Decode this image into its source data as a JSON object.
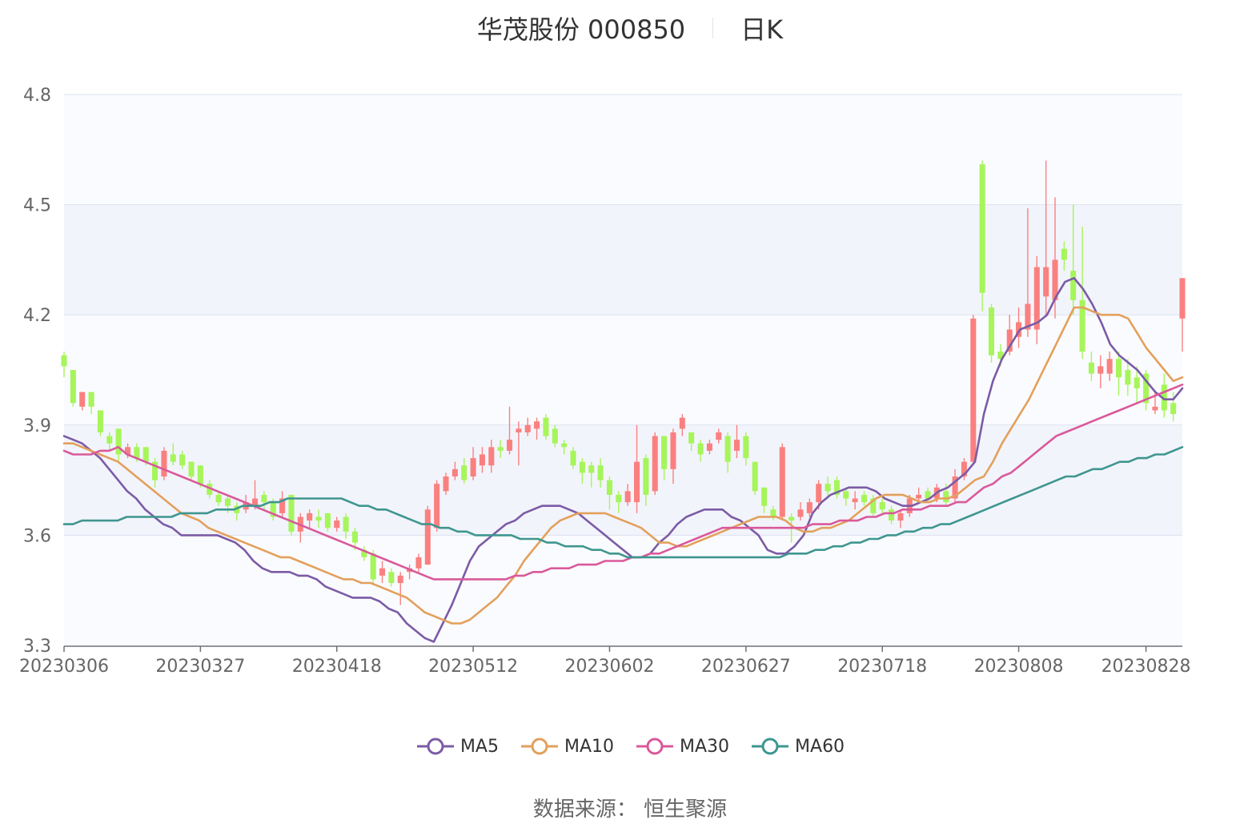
{
  "title": {
    "stock": "华茂股份 000850",
    "period": "日K"
  },
  "source": "数据来源： 恒生聚源",
  "colors": {
    "up": "#fa8080",
    "down": "#a6f55a",
    "MA5": "#7b5ba6",
    "MA10": "#e3a05c",
    "MA30": "#d9599a",
    "MA60": "#3e968f",
    "grid": "#dde1f0",
    "band": "#f2f4fb"
  },
  "chart_data": {
    "type": "candlestick",
    "ylim": [
      3.3,
      4.8
    ],
    "yticks": [
      "3.3",
      "3.6",
      "3.9",
      "4.2",
      "4.5",
      "4.8"
    ],
    "xticks": [
      {
        "i": 0,
        "label": "20230306"
      },
      {
        "i": 15,
        "label": "20230327"
      },
      {
        "i": 30,
        "label": "20230418"
      },
      {
        "i": 45,
        "label": "20230512"
      },
      {
        "i": 60,
        "label": "20230602"
      },
      {
        "i": 75,
        "label": "20230627"
      },
      {
        "i": 90,
        "label": "20230718"
      },
      {
        "i": 105,
        "label": "20230808"
      },
      {
        "i": 119,
        "label": "20230828"
      }
    ],
    "candles": [
      [
        4.09,
        4.06,
        4.1,
        4.03
      ],
      [
        4.05,
        3.96,
        4.05,
        3.95
      ],
      [
        3.95,
        3.99,
        3.99,
        3.94
      ],
      [
        3.99,
        3.95,
        3.99,
        3.93
      ],
      [
        3.94,
        3.88,
        3.94,
        3.87
      ],
      [
        3.87,
        3.85,
        3.88,
        3.83
      ],
      [
        3.89,
        3.82,
        3.89,
        3.8
      ],
      [
        3.82,
        3.84,
        3.85,
        3.81
      ],
      [
        3.84,
        3.81,
        3.85,
        3.8
      ],
      [
        3.84,
        3.8,
        3.84,
        3.79
      ],
      [
        3.8,
        3.75,
        3.81,
        3.73
      ],
      [
        3.76,
        3.83,
        3.84,
        3.75
      ],
      [
        3.82,
        3.8,
        3.85,
        3.79
      ],
      [
        3.82,
        3.79,
        3.83,
        3.78
      ],
      [
        3.8,
        3.76,
        3.8,
        3.75
      ],
      [
        3.79,
        3.74,
        3.79,
        3.73
      ],
      [
        3.74,
        3.71,
        3.75,
        3.7
      ],
      [
        3.71,
        3.69,
        3.72,
        3.68
      ],
      [
        3.7,
        3.68,
        3.71,
        3.66
      ],
      [
        3.68,
        3.66,
        3.69,
        3.64
      ],
      [
        3.67,
        3.69,
        3.71,
        3.66
      ],
      [
        3.68,
        3.7,
        3.75,
        3.67
      ],
      [
        3.71,
        3.69,
        3.72,
        3.67
      ],
      [
        3.69,
        3.65,
        3.7,
        3.64
      ],
      [
        3.66,
        3.7,
        3.72,
        3.65
      ],
      [
        3.71,
        3.61,
        3.71,
        3.6
      ],
      [
        3.61,
        3.65,
        3.66,
        3.58
      ],
      [
        3.64,
        3.66,
        3.67,
        3.62
      ],
      [
        3.65,
        3.64,
        3.67,
        3.62
      ],
      [
        3.66,
        3.62,
        3.66,
        3.61
      ],
      [
        3.62,
        3.64,
        3.65,
        3.61
      ],
      [
        3.65,
        3.61,
        3.66,
        3.59
      ],
      [
        3.61,
        3.58,
        3.62,
        3.56
      ],
      [
        3.56,
        3.54,
        3.57,
        3.53
      ],
      [
        3.55,
        3.48,
        3.56,
        3.47
      ],
      [
        3.49,
        3.51,
        3.53,
        3.47
      ],
      [
        3.5,
        3.47,
        3.51,
        3.46
      ],
      [
        3.47,
        3.49,
        3.5,
        3.41
      ],
      [
        3.5,
        3.51,
        3.52,
        3.48
      ],
      [
        3.51,
        3.54,
        3.55,
        3.5
      ],
      [
        3.52,
        3.67,
        3.68,
        3.52
      ],
      [
        3.62,
        3.74,
        3.75,
        3.61
      ],
      [
        3.72,
        3.76,
        3.77,
        3.71
      ],
      [
        3.76,
        3.78,
        3.8,
        3.75
      ],
      [
        3.79,
        3.75,
        3.81,
        3.74
      ],
      [
        3.76,
        3.81,
        3.84,
        3.75
      ],
      [
        3.79,
        3.82,
        3.84,
        3.77
      ],
      [
        3.79,
        3.84,
        3.86,
        3.77
      ],
      [
        3.84,
        3.83,
        3.86,
        3.81
      ],
      [
        3.83,
        3.86,
        3.95,
        3.82
      ],
      [
        3.88,
        3.89,
        3.91,
        3.79
      ],
      [
        3.88,
        3.9,
        3.92,
        3.87
      ],
      [
        3.89,
        3.91,
        3.92,
        3.86
      ],
      [
        3.92,
        3.87,
        3.93,
        3.86
      ],
      [
        3.89,
        3.85,
        3.9,
        3.84
      ],
      [
        3.85,
        3.84,
        3.86,
        3.82
      ],
      [
        3.83,
        3.79,
        3.84,
        3.78
      ],
      [
        3.8,
        3.77,
        3.81,
        3.74
      ],
      [
        3.79,
        3.77,
        3.8,
        3.73
      ],
      [
        3.79,
        3.75,
        3.81,
        3.73
      ],
      [
        3.75,
        3.71,
        3.76,
        3.67
      ],
      [
        3.71,
        3.69,
        3.72,
        3.66
      ],
      [
        3.69,
        3.72,
        3.74,
        3.68
      ],
      [
        3.69,
        3.8,
        3.9,
        3.66
      ],
      [
        3.81,
        3.71,
        3.82,
        3.68
      ],
      [
        3.72,
        3.87,
        3.88,
        3.71
      ],
      [
        3.87,
        3.78,
        3.87,
        3.75
      ],
      [
        3.78,
        3.88,
        3.89,
        3.74
      ],
      [
        3.89,
        3.92,
        3.93,
        3.87
      ],
      [
        3.88,
        3.85,
        3.88,
        3.83
      ],
      [
        3.85,
        3.82,
        3.86,
        3.8
      ],
      [
        3.83,
        3.85,
        3.86,
        3.82
      ],
      [
        3.86,
        3.88,
        3.89,
        3.85
      ],
      [
        3.87,
        3.8,
        3.88,
        3.77
      ],
      [
        3.83,
        3.86,
        3.9,
        3.81
      ],
      [
        3.87,
        3.81,
        3.88,
        3.79
      ],
      [
        3.8,
        3.72,
        3.8,
        3.71
      ],
      [
        3.73,
        3.68,
        3.73,
        3.66
      ],
      [
        3.67,
        3.65,
        3.68,
        3.64
      ],
      [
        3.65,
        3.84,
        3.85,
        3.64
      ],
      [
        3.65,
        3.64,
        3.66,
        3.58
      ],
      [
        3.65,
        3.67,
        3.69,
        3.64
      ],
      [
        3.66,
        3.69,
        3.7,
        3.65
      ],
      [
        3.69,
        3.74,
        3.75,
        3.67
      ],
      [
        3.74,
        3.72,
        3.76,
        3.7
      ],
      [
        3.75,
        3.71,
        3.76,
        3.7
      ],
      [
        3.72,
        3.7,
        3.73,
        3.68
      ],
      [
        3.69,
        3.7,
        3.72,
        3.67
      ],
      [
        3.71,
        3.69,
        3.72,
        3.68
      ],
      [
        3.7,
        3.66,
        3.71,
        3.65
      ],
      [
        3.69,
        3.67,
        3.7,
        3.66
      ],
      [
        3.67,
        3.64,
        3.68,
        3.63
      ],
      [
        3.64,
        3.66,
        3.67,
        3.62
      ],
      [
        3.66,
        3.7,
        3.71,
        3.65
      ],
      [
        3.7,
        3.71,
        3.73,
        3.69
      ],
      [
        3.72,
        3.7,
        3.73,
        3.69
      ],
      [
        3.7,
        3.73,
        3.74,
        3.69
      ],
      [
        3.72,
        3.69,
        3.74,
        3.68
      ],
      [
        3.7,
        3.76,
        3.78,
        3.69
      ],
      [
        3.76,
        3.8,
        3.81,
        3.75
      ],
      [
        3.8,
        4.19,
        4.2,
        3.79
      ],
      [
        4.61,
        4.26,
        4.62,
        4.21
      ],
      [
        4.22,
        4.09,
        4.23,
        4.07
      ],
      [
        4.1,
        4.08,
        4.12,
        4.06
      ],
      [
        4.1,
        4.16,
        4.2,
        4.09
      ],
      [
        4.14,
        4.18,
        4.22,
        4.11
      ],
      [
        4.16,
        4.23,
        4.49,
        4.14
      ],
      [
        4.16,
        4.33,
        4.36,
        4.12
      ],
      [
        4.25,
        4.33,
        4.62,
        4.2
      ],
      [
        4.24,
        4.35,
        4.52,
        4.19
      ],
      [
        4.38,
        4.35,
        4.4,
        4.32
      ],
      [
        4.32,
        4.24,
        4.5,
        4.2
      ],
      [
        4.24,
        4.1,
        4.44,
        4.08
      ],
      [
        4.07,
        4.04,
        4.1,
        4.02
      ],
      [
        4.04,
        4.06,
        4.09,
        4.0
      ],
      [
        4.04,
        4.08,
        4.1,
        4.02
      ],
      [
        4.08,
        4.03,
        4.1,
        3.98
      ],
      [
        4.05,
        4.01,
        4.08,
        3.98
      ],
      [
        4.03,
        4.0,
        4.06,
        3.96
      ],
      [
        4.04,
        3.96,
        4.05,
        3.94
      ],
      [
        3.94,
        3.95,
        3.99,
        3.93
      ],
      [
        4.01,
        3.94,
        4.04,
        3.92
      ],
      [
        3.96,
        3.93,
        3.99,
        3.91
      ],
      [
        4.19,
        4.3,
        4.3,
        4.1
      ]
    ],
    "ma_series": [
      {
        "name": "MA5",
        "values": [
          3.87,
          3.86,
          3.85,
          3.83,
          3.81,
          3.78,
          3.75,
          3.72,
          3.7,
          3.67,
          3.65,
          3.63,
          3.62,
          3.6,
          3.6,
          3.6,
          3.6,
          3.6,
          3.59,
          3.58,
          3.56,
          3.53,
          3.51,
          3.5,
          3.5,
          3.5,
          3.49,
          3.49,
          3.48,
          3.46,
          3.45,
          3.44,
          3.43,
          3.43,
          3.43,
          3.42,
          3.4,
          3.39,
          3.36,
          3.34,
          3.32,
          3.31,
          3.36,
          3.41,
          3.47,
          3.53,
          3.57,
          3.59,
          3.61,
          3.63,
          3.64,
          3.66,
          3.67,
          3.68,
          3.68,
          3.68,
          3.67,
          3.66,
          3.64,
          3.62,
          3.6,
          3.58,
          3.56,
          3.54,
          3.54,
          3.55,
          3.58,
          3.6,
          3.63,
          3.65,
          3.66,
          3.67,
          3.67,
          3.67,
          3.65,
          3.64,
          3.62,
          3.6,
          3.56,
          3.55,
          3.55,
          3.57,
          3.6,
          3.66,
          3.69,
          3.71,
          3.72,
          3.73,
          3.73,
          3.73,
          3.72,
          3.7,
          3.69,
          3.68,
          3.68,
          3.69,
          3.7,
          3.72,
          3.73,
          3.75,
          3.77,
          3.8,
          3.93,
          4.02,
          4.08,
          4.12,
          4.16,
          4.17,
          4.18,
          4.2,
          4.25,
          4.29,
          4.3,
          4.27,
          4.23,
          4.18,
          4.12,
          4.09,
          4.07,
          4.05,
          4.02,
          3.99,
          3.97,
          3.97,
          4.0
        ]
      },
      {
        "name": "MA10",
        "values": [
          3.85,
          3.85,
          3.84,
          3.83,
          3.82,
          3.81,
          3.8,
          3.78,
          3.76,
          3.74,
          3.72,
          3.7,
          3.68,
          3.66,
          3.65,
          3.64,
          3.62,
          3.61,
          3.6,
          3.59,
          3.58,
          3.57,
          3.56,
          3.55,
          3.54,
          3.54,
          3.53,
          3.52,
          3.51,
          3.5,
          3.49,
          3.48,
          3.48,
          3.47,
          3.47,
          3.46,
          3.45,
          3.44,
          3.43,
          3.41,
          3.39,
          3.38,
          3.37,
          3.36,
          3.36,
          3.37,
          3.39,
          3.41,
          3.43,
          3.46,
          3.49,
          3.53,
          3.56,
          3.59,
          3.62,
          3.64,
          3.65,
          3.66,
          3.66,
          3.66,
          3.66,
          3.65,
          3.64,
          3.63,
          3.62,
          3.6,
          3.58,
          3.58,
          3.57,
          3.57,
          3.58,
          3.59,
          3.6,
          3.61,
          3.62,
          3.63,
          3.64,
          3.65,
          3.65,
          3.65,
          3.64,
          3.62,
          3.61,
          3.61,
          3.62,
          3.62,
          3.63,
          3.64,
          3.66,
          3.68,
          3.7,
          3.71,
          3.71,
          3.71,
          3.7,
          3.69,
          3.69,
          3.7,
          3.7,
          3.71,
          3.73,
          3.75,
          3.76,
          3.8,
          3.85,
          3.89,
          3.93,
          3.97,
          4.02,
          4.07,
          4.12,
          4.17,
          4.22,
          4.22,
          4.21,
          4.2,
          4.2,
          4.2,
          4.19,
          4.15,
          4.11,
          4.08,
          4.05,
          4.02,
          4.03
        ]
      },
      {
        "name": "MA30",
        "values": [
          3.83,
          3.82,
          3.82,
          3.82,
          3.83,
          3.83,
          3.84,
          3.82,
          3.81,
          3.8,
          3.79,
          3.78,
          3.77,
          3.76,
          3.75,
          3.74,
          3.73,
          3.72,
          3.71,
          3.7,
          3.69,
          3.68,
          3.67,
          3.66,
          3.65,
          3.64,
          3.63,
          3.62,
          3.61,
          3.6,
          3.59,
          3.58,
          3.57,
          3.56,
          3.55,
          3.54,
          3.53,
          3.52,
          3.51,
          3.5,
          3.49,
          3.48,
          3.48,
          3.48,
          3.48,
          3.48,
          3.48,
          3.48,
          3.48,
          3.48,
          3.49,
          3.49,
          3.5,
          3.5,
          3.51,
          3.51,
          3.51,
          3.52,
          3.52,
          3.52,
          3.53,
          3.53,
          3.53,
          3.54,
          3.54,
          3.55,
          3.55,
          3.56,
          3.57,
          3.58,
          3.59,
          3.6,
          3.61,
          3.62,
          3.62,
          3.62,
          3.62,
          3.62,
          3.62,
          3.62,
          3.62,
          3.62,
          3.62,
          3.63,
          3.63,
          3.63,
          3.64,
          3.64,
          3.64,
          3.65,
          3.65,
          3.66,
          3.66,
          3.67,
          3.67,
          3.67,
          3.68,
          3.68,
          3.68,
          3.69,
          3.69,
          3.71,
          3.73,
          3.74,
          3.76,
          3.77,
          3.79,
          3.81,
          3.83,
          3.85,
          3.87,
          3.88,
          3.89,
          3.9,
          3.91,
          3.92,
          3.93,
          3.94,
          3.95,
          3.96,
          3.97,
          3.98,
          3.99,
          4.0,
          4.01
        ]
      },
      {
        "name": "MA60",
        "values": [
          3.63,
          3.63,
          3.64,
          3.64,
          3.64,
          3.64,
          3.64,
          3.65,
          3.65,
          3.65,
          3.65,
          3.65,
          3.65,
          3.66,
          3.66,
          3.66,
          3.66,
          3.67,
          3.67,
          3.67,
          3.68,
          3.68,
          3.68,
          3.69,
          3.69,
          3.7,
          3.7,
          3.7,
          3.7,
          3.7,
          3.7,
          3.7,
          3.69,
          3.68,
          3.68,
          3.67,
          3.67,
          3.66,
          3.65,
          3.64,
          3.63,
          3.63,
          3.62,
          3.62,
          3.61,
          3.61,
          3.6,
          3.6,
          3.6,
          3.6,
          3.6,
          3.59,
          3.59,
          3.59,
          3.58,
          3.58,
          3.57,
          3.57,
          3.57,
          3.56,
          3.56,
          3.55,
          3.55,
          3.54,
          3.54,
          3.54,
          3.54,
          3.54,
          3.54,
          3.54,
          3.54,
          3.54,
          3.54,
          3.54,
          3.54,
          3.54,
          3.54,
          3.54,
          3.54,
          3.54,
          3.54,
          3.55,
          3.55,
          3.55,
          3.56,
          3.56,
          3.57,
          3.57,
          3.58,
          3.58,
          3.59,
          3.59,
          3.6,
          3.6,
          3.61,
          3.61,
          3.62,
          3.62,
          3.63,
          3.63,
          3.64,
          3.65,
          3.66,
          3.67,
          3.68,
          3.69,
          3.7,
          3.71,
          3.72,
          3.73,
          3.74,
          3.75,
          3.76,
          3.76,
          3.77,
          3.78,
          3.78,
          3.79,
          3.8,
          3.8,
          3.81,
          3.81,
          3.82,
          3.82,
          3.83,
          3.84
        ]
      }
    ]
  }
}
